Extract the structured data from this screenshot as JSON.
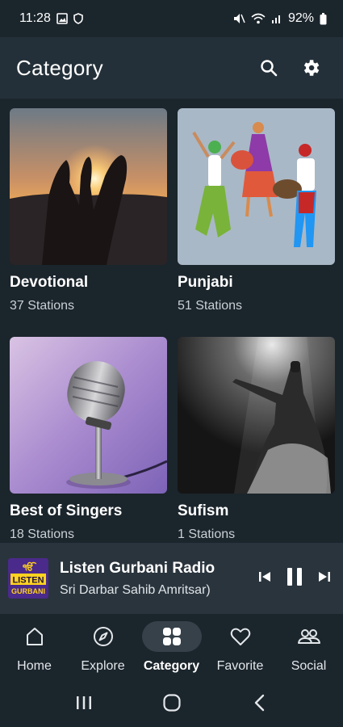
{
  "status_bar": {
    "time": "11:28",
    "battery": "92%"
  },
  "header": {
    "title": "Category"
  },
  "categories": [
    {
      "title": "Devotional",
      "count": "37 Stations"
    },
    {
      "title": "Punjabi",
      "count": "51 Stations"
    },
    {
      "title": "Best of Singers",
      "count": "18 Stations"
    },
    {
      "title": "Sufism",
      "count": "1 Stations"
    }
  ],
  "mini_player": {
    "logo_text": "LISTEN GURBANI",
    "title": "Listen Gurbani Radio",
    "subtitle": "Sri Darbar Sahib Amritsar)"
  },
  "bottom_nav": [
    {
      "label": "Home",
      "icon": "home-icon"
    },
    {
      "label": "Explore",
      "icon": "compass-icon"
    },
    {
      "label": "Category",
      "icon": "grid-icon",
      "active": true
    },
    {
      "label": "Favorite",
      "icon": "heart-icon"
    },
    {
      "label": "Social",
      "icon": "people-icon"
    }
  ],
  "colors": {
    "background": "#1b252c",
    "appbar": "#243039",
    "player": "#2a343d",
    "active_pill": "#36414a"
  }
}
